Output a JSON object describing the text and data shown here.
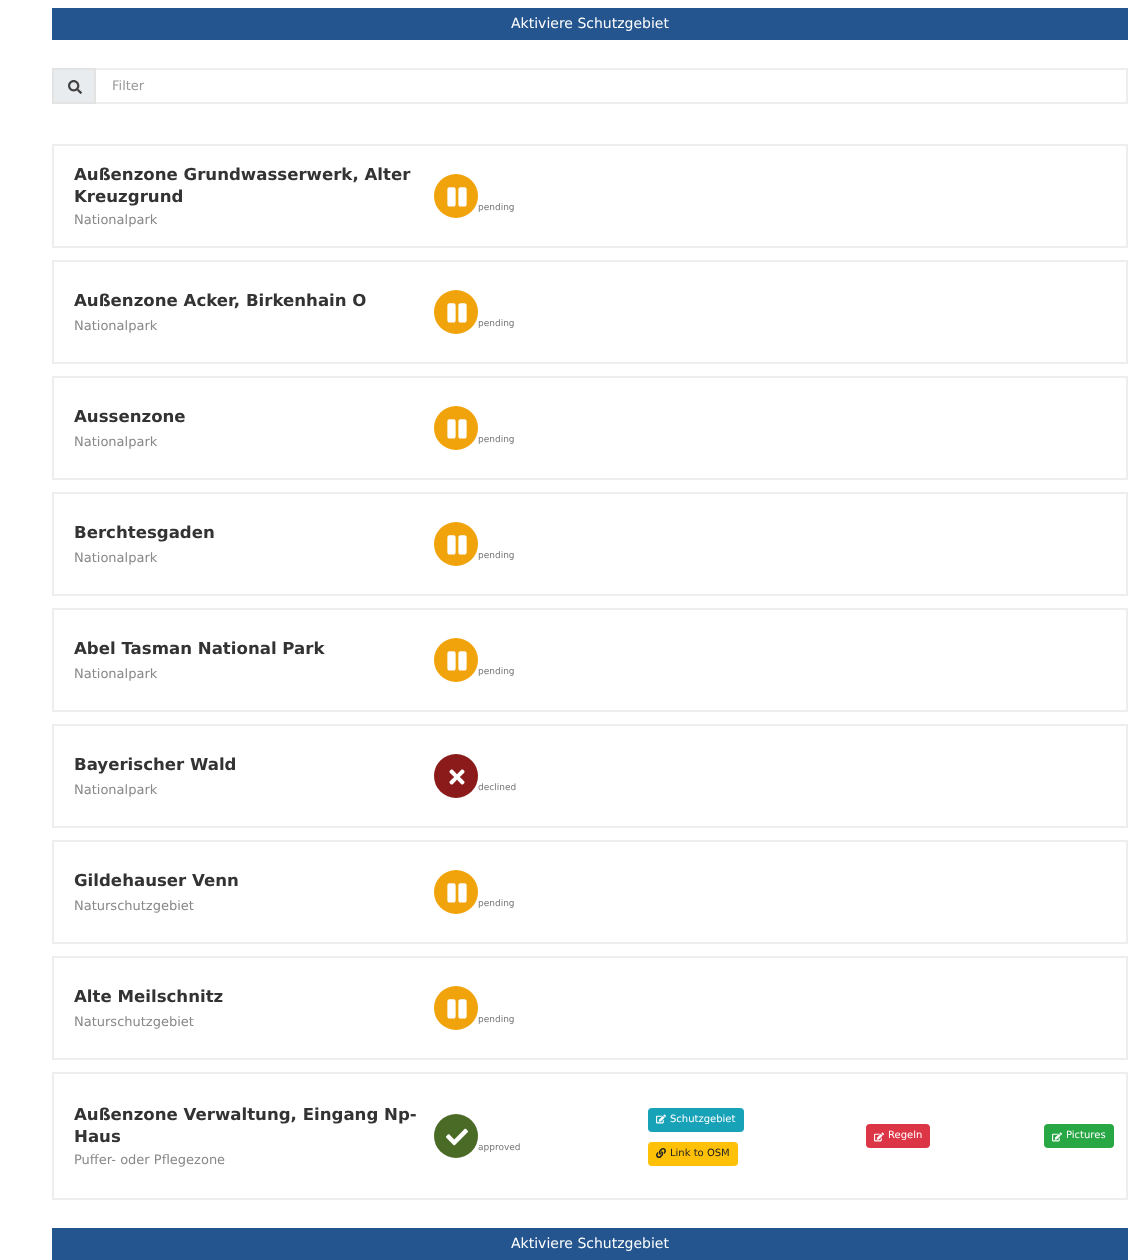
{
  "header_button": "Aktiviere Schutzgebiet",
  "filter": {
    "placeholder": "Filter"
  },
  "areas": [
    {
      "name": "Außenzone Grundwasserwerk, Alter Kreuzgrund",
      "category": "Nationalpark",
      "status": "pending"
    },
    {
      "name": "Außenzone Acker, Birkenhain O",
      "category": "Nationalpark",
      "status": "pending"
    },
    {
      "name": "Aussenzone",
      "category": "Nationalpark",
      "status": "pending"
    },
    {
      "name": "Berchtesgaden",
      "category": "Nationalpark",
      "status": "pending"
    },
    {
      "name": "Abel Tasman National Park",
      "category": "Nationalpark",
      "status": "pending"
    },
    {
      "name": "Bayerischer Wald",
      "category": "Nationalpark",
      "status": "declined"
    },
    {
      "name": "Gildehauser Venn",
      "category": "Naturschutzgebiet",
      "status": "pending"
    },
    {
      "name": "Alte Meilschnitz",
      "category": "Naturschutzgebiet",
      "status": "pending"
    },
    {
      "name": "Außenzone Verwaltung, Eingang Np-Haus",
      "category": "Puffer- oder Pflegezone",
      "status": "approved",
      "actions": [
        {
          "label": "Schutzgebiet",
          "kind": "info"
        },
        {
          "label": "Regeln",
          "kind": "danger"
        },
        {
          "label": "Pictures",
          "kind": "success"
        },
        {
          "label": "Link to OSM",
          "kind": "warning"
        }
      ]
    }
  ],
  "footer_button": "Aktiviere Schutzgebiet"
}
